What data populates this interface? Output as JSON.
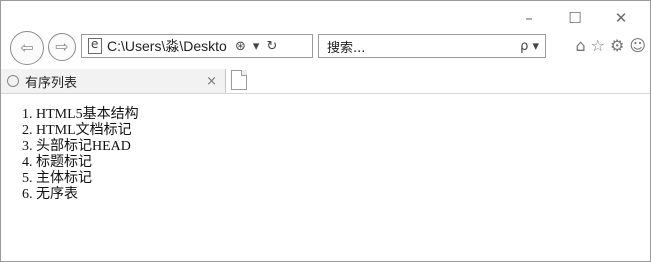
{
  "window": {
    "minimize_glyph": "–",
    "maximize_glyph": "☐",
    "close_glyph": "✕"
  },
  "nav": {
    "address": "C:\\Users\\淼\\Deskto",
    "search_placeholder": "搜索...",
    "search_button": "ρ ▾"
  },
  "tab": {
    "title": "有序列表",
    "close_glyph": "×"
  },
  "list": {
    "items": [
      "HTML5基本结构",
      "HTML文档标记",
      "头部标记HEAD",
      "标题标记",
      "主体标记",
      "无序表"
    ]
  }
}
